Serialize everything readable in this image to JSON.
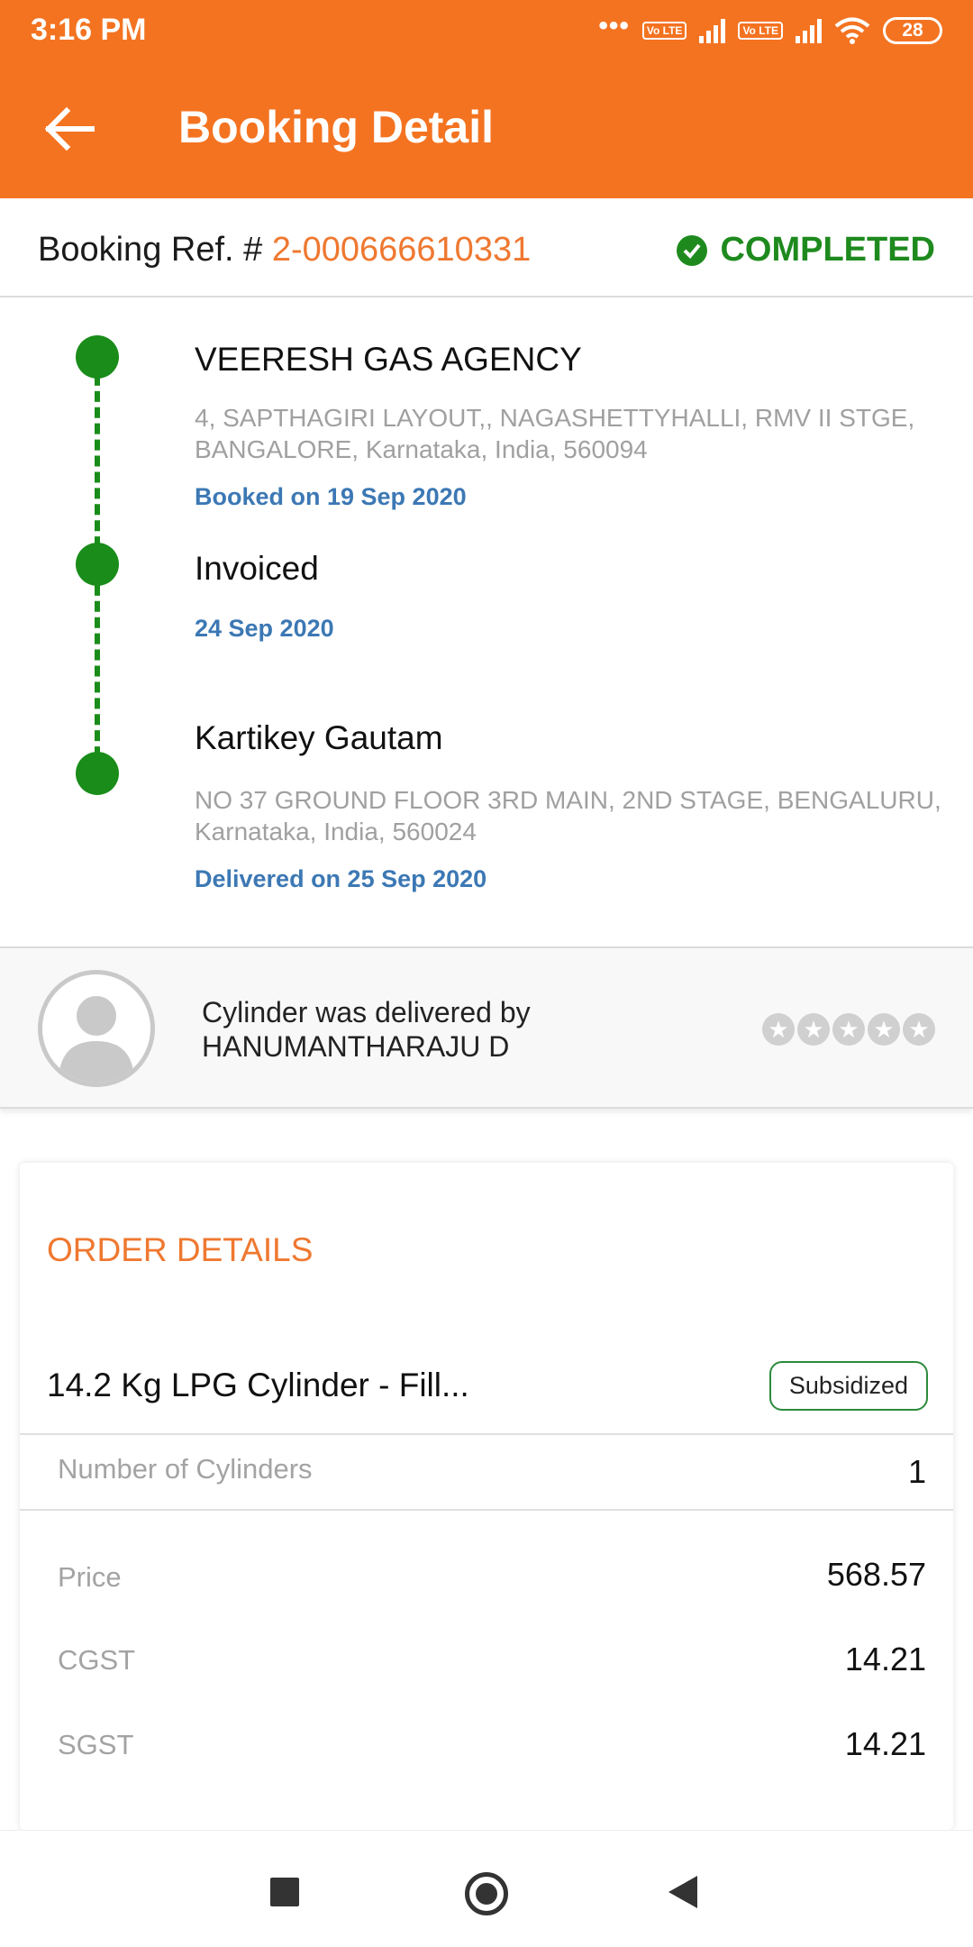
{
  "status_bar": {
    "time": "3:16 PM",
    "dots": "•••",
    "volte_label_1": "Vo LTE",
    "volte_label_2": "Vo LTE",
    "battery": "28",
    "icons": [
      "signal-icon",
      "wifi-icon",
      "battery-icon"
    ]
  },
  "app_bar": {
    "title": "Booking Detail",
    "back_icon": "arrow-left-icon"
  },
  "booking": {
    "ref_label": "Booking Ref. # ",
    "ref_number": "2-000666610331",
    "status": "COMPLETED",
    "status_color": "#1e8a1e"
  },
  "timeline": [
    {
      "title": "VEERESH GAS AGENCY",
      "address": "4, SAPTHAGIRI LAYOUT,, NAGASHETTYHALLI, RMV II STGE, BANGALORE, Karnataka, India, 560094",
      "date": "Booked on 19 Sep 2020"
    },
    {
      "title": "Invoiced",
      "address": "",
      "date": "24 Sep 2020"
    },
    {
      "title": "Kartikey Gautam",
      "address": "NO 37 GROUND FLOOR 3RD MAIN, 2ND STAGE, BENGALURU, Karnataka, India, 560024",
      "date": "Delivered on 25 Sep 2020"
    }
  ],
  "delivery": {
    "line1": "Cylinder was delivered by",
    "line2": "HANUMANTHARAJU D",
    "rating": 0,
    "rating_max": 5
  },
  "order": {
    "heading": "ORDER DETAILS",
    "product": "14.2 Kg LPG Cylinder - Fill...",
    "badge": "Subsidized",
    "rows": [
      {
        "label": "Number of Cylinders",
        "value": "1"
      },
      {
        "label": "Price",
        "value": "568.57"
      },
      {
        "label": "CGST",
        "value": "14.21"
      },
      {
        "label": "SGST",
        "value": "14.21"
      }
    ]
  },
  "colors": {
    "brand": "#f47321",
    "accent_text": "#ef7830",
    "timeline_green": "#1a8c1a",
    "date_blue": "#3c78b4"
  }
}
